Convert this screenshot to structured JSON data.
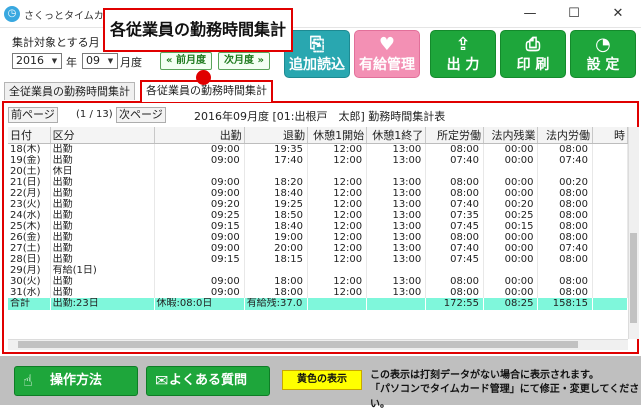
{
  "window": {
    "title": "さくっとタイムカード計算",
    "minimize": "—",
    "maximize": "☐",
    "close": "✕"
  },
  "callout": "各従業員の勤務時間集計",
  "period": {
    "label": "集計対象とする月",
    "year": "2016",
    "year_unit": "年",
    "month": "09",
    "month_unit": "月度",
    "prev_btn": "« 前月度",
    "next_btn": "次月度 »"
  },
  "toolbar": {
    "add_read": "追加読込",
    "paid_leave": "有給管理",
    "output": "出 力",
    "print": "印 刷",
    "settings": "設 定",
    "paid_leave_icon_text": "休"
  },
  "tabs": [
    "全従業員の勤務時間集計",
    "各従業員の勤務時間集計"
  ],
  "pager": {
    "prev": "前ページ",
    "indicator": "(1 / 13)",
    "next": "次ページ",
    "report_title": "2016年09月度 [01:出根戸　太郎] 勤務時間集計表"
  },
  "table": {
    "headers": [
      "日付",
      "区分",
      "出勤",
      "退勤",
      "休憩1開始",
      "休憩1終了",
      "所定労働",
      "法内残業",
      "法内労働",
      "時"
    ],
    "rows": [
      [
        "18(木)",
        "出勤",
        "09:00",
        "19:35",
        "12:00",
        "13:00",
        "08:00",
        "00:00",
        "08:00"
      ],
      [
        "19(金)",
        "出勤",
        "09:00",
        "17:40",
        "12:00",
        "13:00",
        "07:40",
        "00:00",
        "07:40"
      ],
      [
        "20(土)",
        "休日",
        "",
        "",
        "",
        "",
        "",
        "",
        ""
      ],
      [
        "21(日)",
        "出勤",
        "09:00",
        "18:20",
        "12:00",
        "13:00",
        "08:00",
        "00:00",
        "00:20"
      ],
      [
        "22(月)",
        "出勤",
        "09:00",
        "18:40",
        "12:00",
        "13:00",
        "08:00",
        "00:00",
        "08:00"
      ],
      [
        "23(火)",
        "出勤",
        "09:20",
        "19:25",
        "12:00",
        "13:00",
        "07:40",
        "00:20",
        "08:00"
      ],
      [
        "24(水)",
        "出勤",
        "09:25",
        "18:50",
        "12:00",
        "13:00",
        "07:35",
        "00:25",
        "08:00"
      ],
      [
        "25(木)",
        "出勤",
        "09:15",
        "18:40",
        "12:00",
        "13:00",
        "07:45",
        "00:15",
        "08:00"
      ],
      [
        "26(金)",
        "出勤",
        "09:00",
        "19:00",
        "12:00",
        "13:00",
        "08:00",
        "00:00",
        "08:00"
      ],
      [
        "27(土)",
        "出勤",
        "09:00",
        "20:00",
        "12:00",
        "13:00",
        "07:40",
        "00:00",
        "07:40"
      ],
      [
        "28(日)",
        "出勤",
        "09:15",
        "18:15",
        "12:00",
        "13:00",
        "07:45",
        "00:00",
        "08:00"
      ],
      [
        "29(月)",
        "有給(1日)",
        "",
        "",
        "",
        "",
        "",
        "",
        ""
      ],
      [
        "30(火)",
        "出勤",
        "09:00",
        "18:00",
        "12:00",
        "13:00",
        "08:00",
        "00:00",
        "08:00"
      ],
      [
        "31(水)",
        "出勤",
        "09:00",
        "18:00",
        "12:00",
        "13:00",
        "08:00",
        "00:00",
        "08:00"
      ]
    ],
    "total": [
      "合計",
      "出勤:23日",
      "休暇:08:0日",
      "有給残:37.0",
      "",
      "",
      "172:55",
      "08:25",
      "158:15"
    ]
  },
  "footer": {
    "howto": "操作方法",
    "faq": "よくある質問",
    "yellow_label": "黄色の表示",
    "note1": "この表示は打刻データがない場合に表示されます。",
    "note2": "「パソコンでタイムカード管理」にて修正・変更してください。"
  }
}
